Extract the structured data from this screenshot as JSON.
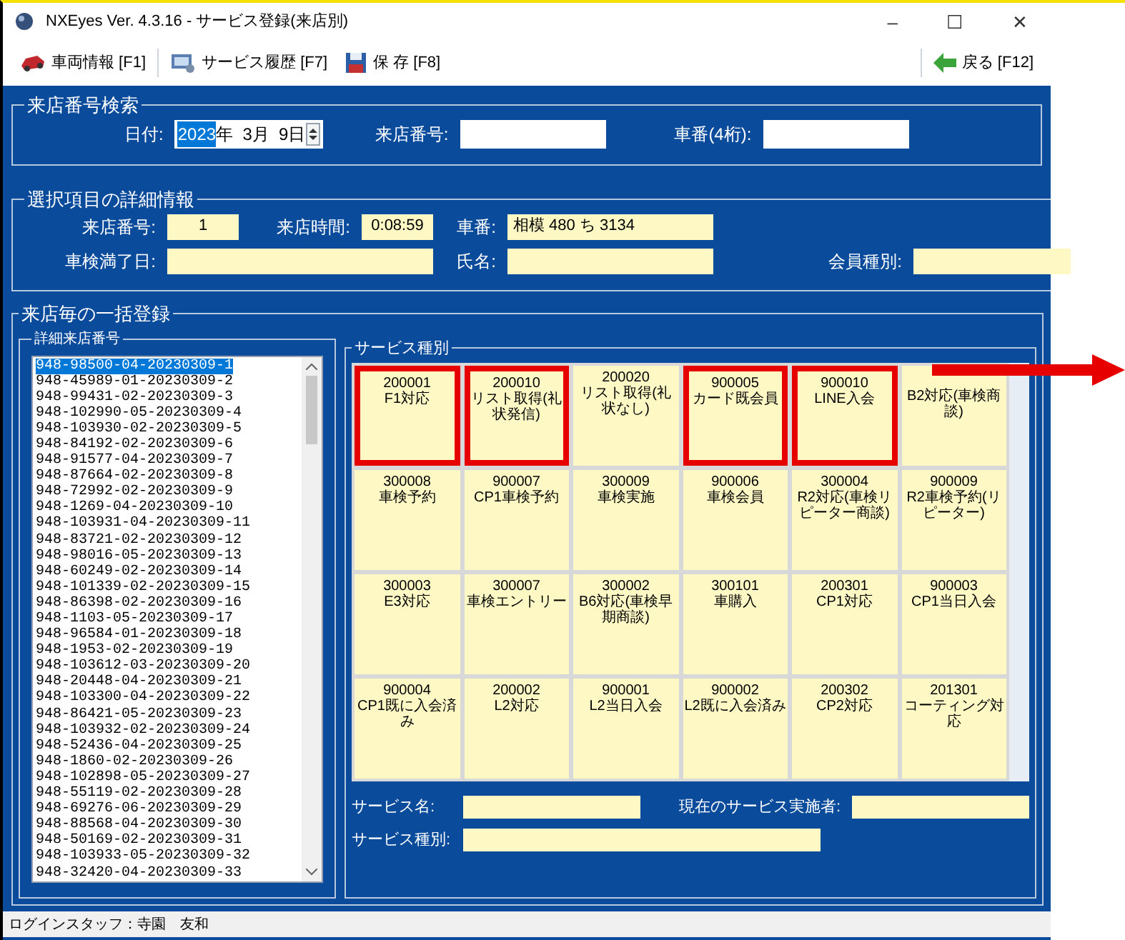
{
  "window": {
    "title": "NXEyes Ver. 4.3.16 - サービス登録(来店別)",
    "controls": [
      "–",
      "☐",
      "✕"
    ]
  },
  "toolbar": {
    "left": [
      {
        "kind": "car",
        "label": "車両情報 [F1]"
      },
      {
        "kind": "history",
        "label": "サービス履歴 [F7]"
      },
      {
        "kind": "save",
        "label": "保 存 [F8]"
      }
    ],
    "right": {
      "kind": "back",
      "label": "戻る [F12]"
    }
  },
  "search": {
    "legend": "来店番号検索",
    "date_label": "日付:",
    "date_year": "2023",
    "date_rest": "年  3月  9日",
    "visit_label": "来店番号:",
    "plate_label": "車番(4桁):"
  },
  "details": {
    "legend": "選択項目の詳細情報",
    "fields": [
      {
        "label": "来店番号:",
        "value": "1"
      },
      {
        "label": "来店時間:",
        "value": "0:08:59"
      },
      {
        "label": "車番:",
        "value": "相模 480 ち 3134"
      },
      {
        "label": "車検満了日:"
      },
      {
        "label": "氏名:"
      },
      {
        "label": "会員種別:"
      }
    ]
  },
  "bulk": {
    "legend": "来店毎の一括登録",
    "list_legend": "詳細来店番号",
    "items": [
      {
        "text": "948-98500-04-20230309-1",
        "selected": true
      },
      {
        "text": "948-45989-01-20230309-2",
        "selected": false
      },
      {
        "text": "948-99431-02-20230309-3",
        "selected": false
      },
      {
        "text": "948-102990-05-20230309-4",
        "selected": false
      },
      {
        "text": "948-103930-02-20230309-5",
        "selected": false
      },
      {
        "text": "948-84192-02-20230309-6",
        "selected": false
      },
      {
        "text": "948-91577-04-20230309-7",
        "selected": false
      },
      {
        "text": "948-87664-02-20230309-8",
        "selected": false
      },
      {
        "text": "948-72992-02-20230309-9",
        "selected": false
      },
      {
        "text": "948-1269-04-20230309-10",
        "selected": false
      },
      {
        "text": "948-103931-04-20230309-11",
        "selected": false
      },
      {
        "text": "948-83721-02-20230309-12",
        "selected": false
      },
      {
        "text": "948-98016-05-20230309-13",
        "selected": false
      },
      {
        "text": "948-60249-02-20230309-14",
        "selected": false
      },
      {
        "text": "948-101339-02-20230309-15",
        "selected": false
      },
      {
        "text": "948-86398-02-20230309-16",
        "selected": false
      },
      {
        "text": "948-1103-05-20230309-17",
        "selected": false
      },
      {
        "text": "948-96584-01-20230309-18",
        "selected": false
      },
      {
        "text": "948-1953-02-20230309-19",
        "selected": false
      },
      {
        "text": "948-103612-03-20230309-20",
        "selected": false
      },
      {
        "text": "948-20448-04-20230309-21",
        "selected": false
      },
      {
        "text": "948-103300-04-20230309-22",
        "selected": false
      },
      {
        "text": "948-86421-05-20230309-23",
        "selected": false
      },
      {
        "text": "948-103932-02-20230309-24",
        "selected": false
      },
      {
        "text": "948-52436-04-20230309-25",
        "selected": false
      },
      {
        "text": "948-1860-02-20230309-26",
        "selected": false
      },
      {
        "text": "948-102898-05-20230309-27",
        "selected": false
      },
      {
        "text": "948-55119-02-20230309-28",
        "selected": false
      },
      {
        "text": "948-69276-06-20230309-29",
        "selected": false
      },
      {
        "text": "948-88568-04-20230309-30",
        "selected": false
      },
      {
        "text": "948-50169-02-20230309-31",
        "selected": false
      },
      {
        "text": "948-103933-05-20230309-32",
        "selected": false
      },
      {
        "text": "948-32420-04-20230309-33",
        "selected": false
      }
    ],
    "service_legend": "サービス種別",
    "tiles": [
      {
        "code": "200001",
        "name": "F1対応",
        "highlighted": true
      },
      {
        "code": "200010",
        "name": "リスト取得(礼状発信)",
        "highlighted": true
      },
      {
        "code": "200020",
        "name": "リスト取得(礼状なし)",
        "highlighted": false
      },
      {
        "code": "900005",
        "name": "カード既会員",
        "highlighted": true
      },
      {
        "code": "900010",
        "name": "LINE入会",
        "highlighted": true
      },
      {
        "name": "B2対応(車検商談)",
        "highlighted": false
      },
      {
        "code": "300008",
        "name": "車検予約",
        "highlighted": false
      },
      {
        "code": "900007",
        "name": "CP1車検予約",
        "highlighted": false
      },
      {
        "code": "300009",
        "name": "車検実施",
        "highlighted": false
      },
      {
        "code": "900006",
        "name": "車検会員",
        "highlighted": false
      },
      {
        "code": "300004",
        "name": "R2対応(車検リピーター商談)",
        "highlighted": false
      },
      {
        "code": "900009",
        "name": "R2車検予約(リピーター)",
        "highlighted": false
      },
      {
        "code": "300003",
        "name": "E3対応",
        "highlighted": false
      },
      {
        "code": "300007",
        "name": "車検エントリー",
        "highlighted": false
      },
      {
        "code": "300002",
        "name": "B6対応(車検早期商談)",
        "highlighted": false
      },
      {
        "code": "300101",
        "name": "車購入",
        "highlighted": false
      },
      {
        "code": "200301",
        "name": "CP1対応",
        "highlighted": false
      },
      {
        "code": "900003",
        "name": "CP1当日入会",
        "highlighted": false
      },
      {
        "code": "900004",
        "name": "CP1既に入会済み",
        "highlighted": false
      },
      {
        "code": "200002",
        "name": "L2対応",
        "highlighted": false
      },
      {
        "code": "900001",
        "name": "L2当日入会",
        "highlighted": false
      },
      {
        "code": "900002",
        "name": "L2既に入会済み",
        "highlighted": false
      },
      {
        "code": "200302",
        "name": "CP2対応",
        "highlighted": false
      },
      {
        "code": "201301",
        "name": "コーティング対応",
        "highlighted": false
      }
    ],
    "service_name_label": "サービス名:",
    "operator_label": "現在のサービス実施者:",
    "service_type_label": "サービス種別:"
  },
  "status_bar": "ログインスタッフ：寺園　友和"
}
